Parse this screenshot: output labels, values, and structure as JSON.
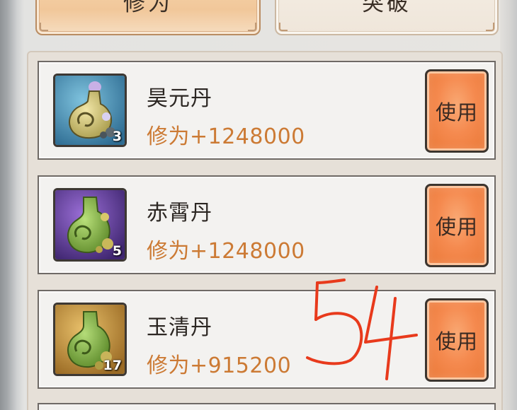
{
  "tabs": [
    {
      "label": "修为",
      "active": true
    },
    {
      "label": "突破",
      "active": false
    }
  ],
  "items": [
    {
      "name": "昊元丹",
      "effect": "修为+1248000",
      "count": "3",
      "use_label": "使用",
      "icon": "blue-gourd-pill-icon"
    },
    {
      "name": "赤霄丹",
      "effect": "修为+1248000",
      "count": "5",
      "use_label": "使用",
      "icon": "purple-gourd-pill-icon"
    },
    {
      "name": "玉清丹",
      "effect": "修为+915200",
      "count": "17",
      "use_label": "使用",
      "icon": "gold-gourd-pill-icon"
    }
  ],
  "annotation": "54",
  "colors": {
    "effect_text": "#cc7a34",
    "use_button": "#f58a4f",
    "annotation_ink": "#e83a1c"
  }
}
